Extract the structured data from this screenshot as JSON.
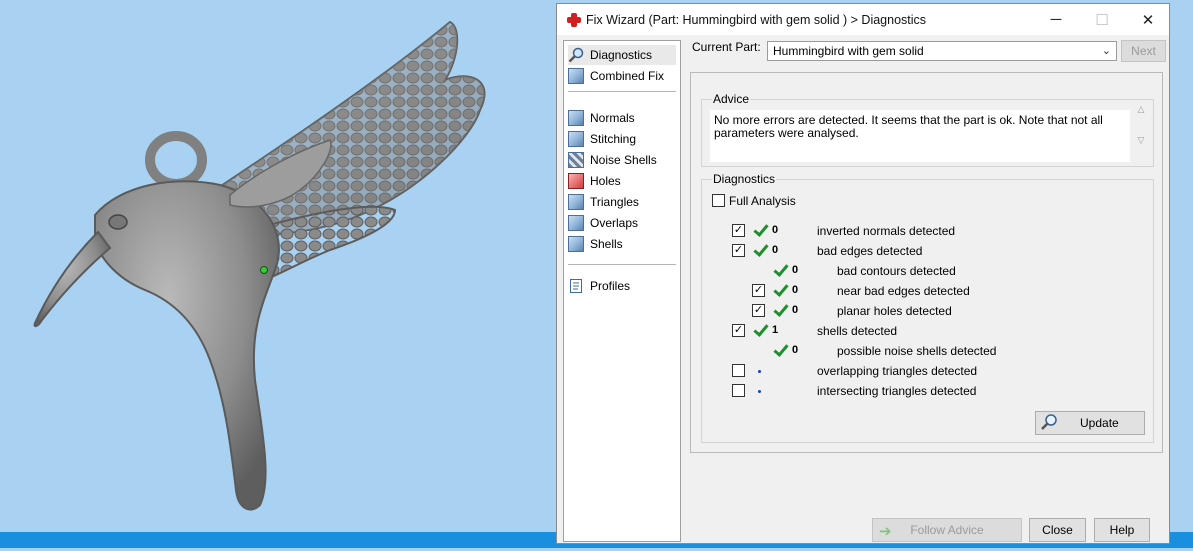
{
  "window": {
    "title": "Fix Wizard (Part: Hummingbird with gem solid ) > Diagnostics",
    "minimize": "─",
    "maximize": "☐",
    "close": "✕"
  },
  "nav": {
    "items": [
      {
        "label": "Diagnostics",
        "icon": "magnifier-icon"
      },
      {
        "label": "Combined Fix",
        "icon": "cube-icon"
      },
      {
        "label": "Normals",
        "icon": "normals-cube-icon"
      },
      {
        "label": "Stitching",
        "icon": "stitching-cube-icon"
      },
      {
        "label": "Noise Shells",
        "icon": "noise-shells-icon"
      },
      {
        "label": "Holes",
        "icon": "holes-cube-icon"
      },
      {
        "label": "Triangles",
        "icon": "triangles-cube-icon"
      },
      {
        "label": "Overlaps",
        "icon": "overlaps-cube-icon"
      },
      {
        "label": "Shells",
        "icon": "shells-cube-icon"
      },
      {
        "label": "Profiles",
        "icon": "document-icon"
      }
    ]
  },
  "header": {
    "current_part_label": "Current Part:",
    "current_part_value": "Hummingbird with gem solid",
    "next": "Next"
  },
  "advice": {
    "title": "Advice",
    "text": "No more errors are detected. It seems that the part is ok. Note that not all parameters were analysed."
  },
  "diagnostics": {
    "title": "Diagnostics",
    "full_analysis": "Full Analysis",
    "rows": [
      {
        "checked": true,
        "has_checkbox": true,
        "status": "ok",
        "count": "0",
        "label": "inverted normals detected",
        "indent": 0
      },
      {
        "checked": true,
        "has_checkbox": true,
        "status": "ok",
        "count": "0",
        "label": "bad edges detected",
        "indent": 0
      },
      {
        "checked": false,
        "has_checkbox": false,
        "status": "ok",
        "count": "0",
        "label": "bad contours detected",
        "indent": 1
      },
      {
        "checked": true,
        "has_checkbox": true,
        "status": "ok",
        "count": "0",
        "label": "near bad edges detected",
        "indent": 1
      },
      {
        "checked": true,
        "has_checkbox": true,
        "status": "ok",
        "count": "0",
        "label": "planar holes detected",
        "indent": 1
      },
      {
        "checked": true,
        "has_checkbox": true,
        "status": "ok",
        "count": "1",
        "label": "shells detected",
        "indent": 0
      },
      {
        "checked": false,
        "has_checkbox": false,
        "status": "ok",
        "count": "0",
        "label": "possible noise shells detected",
        "indent": 1
      },
      {
        "checked": false,
        "has_checkbox": true,
        "status": "pending",
        "count": "",
        "label": "overlapping triangles detected",
        "indent": 0
      },
      {
        "checked": false,
        "has_checkbox": true,
        "status": "pending",
        "count": "",
        "label": "intersecting triangles detected",
        "indent": 0
      }
    ],
    "update": "Update"
  },
  "footer": {
    "follow_advice": "Follow Advice",
    "close": "Close",
    "help": "Help"
  },
  "colors": {
    "background": "#a9d1f2",
    "model": "#8c8c8c",
    "check": "#1e8f2e",
    "taskbar": "#1a8fe0"
  }
}
